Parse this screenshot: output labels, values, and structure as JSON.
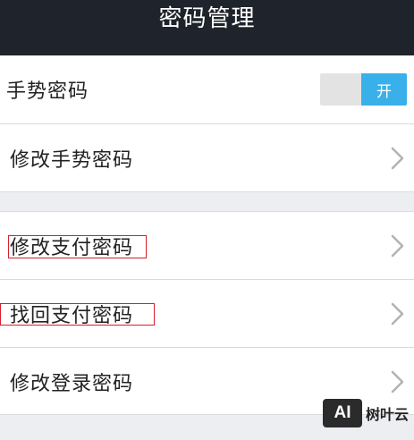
{
  "header": {
    "title": "密码管理"
  },
  "rows": [
    {
      "label": "手势密码",
      "toggle": {
        "state": "on",
        "label": "开"
      }
    },
    {
      "label": "修改手势密码"
    },
    {
      "label": "修改支付密码"
    },
    {
      "label": "找回支付密码"
    },
    {
      "label": "修改登录密码"
    }
  ],
  "watermark": {
    "logo_text": "AI",
    "text": "树叶云"
  },
  "colors": {
    "header_bg": "#1f232b",
    "toggle_on": "#3ab0ea",
    "annotation": "#d21f2b",
    "page_bg": "#eceef1"
  }
}
